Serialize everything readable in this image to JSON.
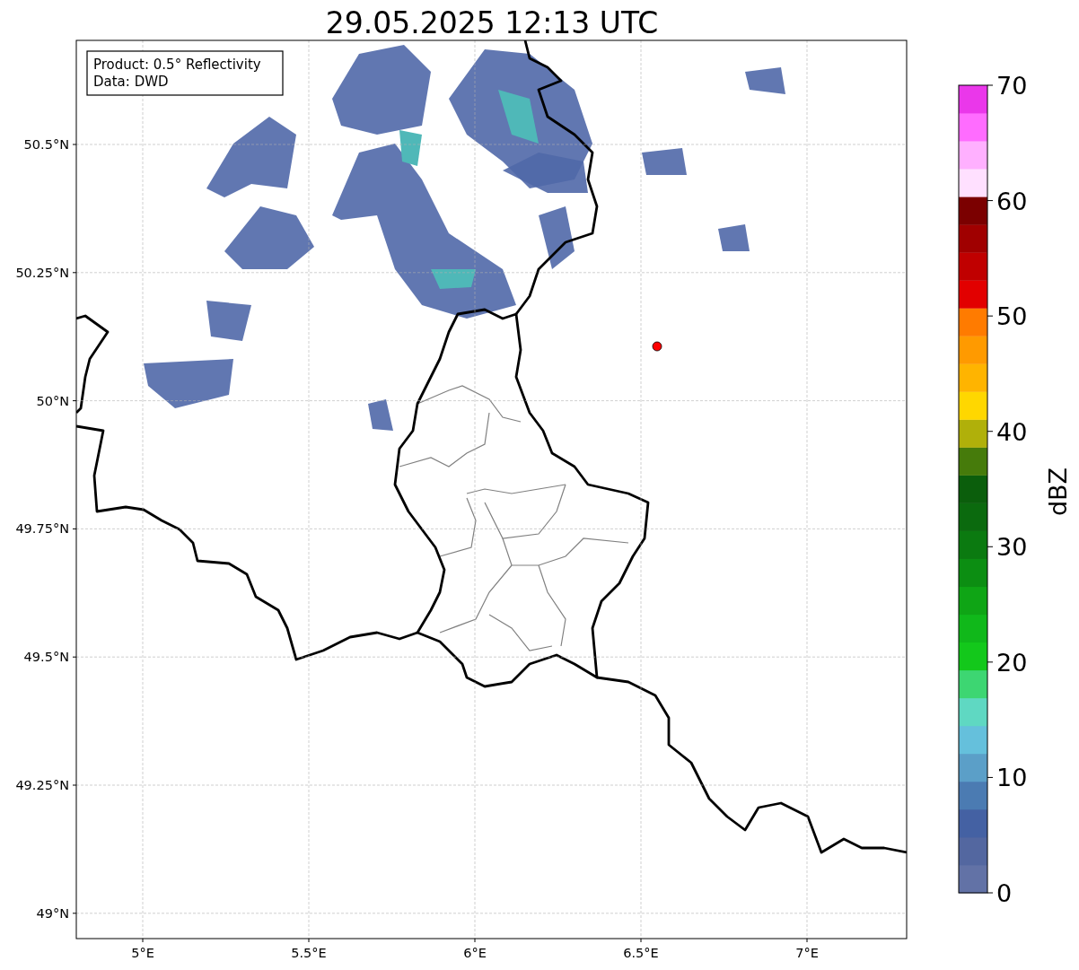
{
  "title": "29.05.2025 12:13 UTC",
  "info_box": [
    "Product: 0.5° Reflectivity",
    "Data: DWD"
  ],
  "map": {
    "xticks": [
      "5°E",
      "5.5°E",
      "6°E",
      "6.5°E",
      "7°E"
    ],
    "yticks": [
      "50.5°N",
      "50.25°N",
      "50°N",
      "49.75°N",
      "49.5°N",
      "49.25°N",
      "49°N"
    ]
  },
  "colorbar": {
    "label": "dBZ",
    "ticks": [
      "70",
      "60",
      "50",
      "40",
      "30",
      "20",
      "10",
      "0"
    ],
    "bins": [
      {
        "color": "#6272a6"
      },
      {
        "color": "#5367a0"
      },
      {
        "color": "#4461a3"
      },
      {
        "color": "#4b7bb2"
      },
      {
        "color": "#5b9fc8"
      },
      {
        "color": "#65c0dc"
      },
      {
        "color": "#5fd8c2"
      },
      {
        "color": "#3dd672"
      },
      {
        "color": "#13c81b"
      },
      {
        "color": "#10b81a"
      },
      {
        "color": "#0fa515"
      },
      {
        "color": "#0c8e12"
      },
      {
        "color": "#0b7a10"
      },
      {
        "color": "#0b6a0e"
      },
      {
        "color": "#0b5e0c"
      },
      {
        "color": "#467b0b"
      },
      {
        "color": "#b0b00a"
      },
      {
        "color": "#ffd700"
      },
      {
        "color": "#ffb400"
      },
      {
        "color": "#ff9a00"
      },
      {
        "color": "#ff7b00"
      },
      {
        "color": "#e20000"
      },
      {
        "color": "#c00000"
      },
      {
        "color": "#a00000"
      },
      {
        "color": "#7b0000"
      },
      {
        "color": "#ffe0ff"
      },
      {
        "color": "#ffb0ff"
      },
      {
        "color": "#ff6cff"
      },
      {
        "color": "#ea37ea"
      }
    ]
  }
}
